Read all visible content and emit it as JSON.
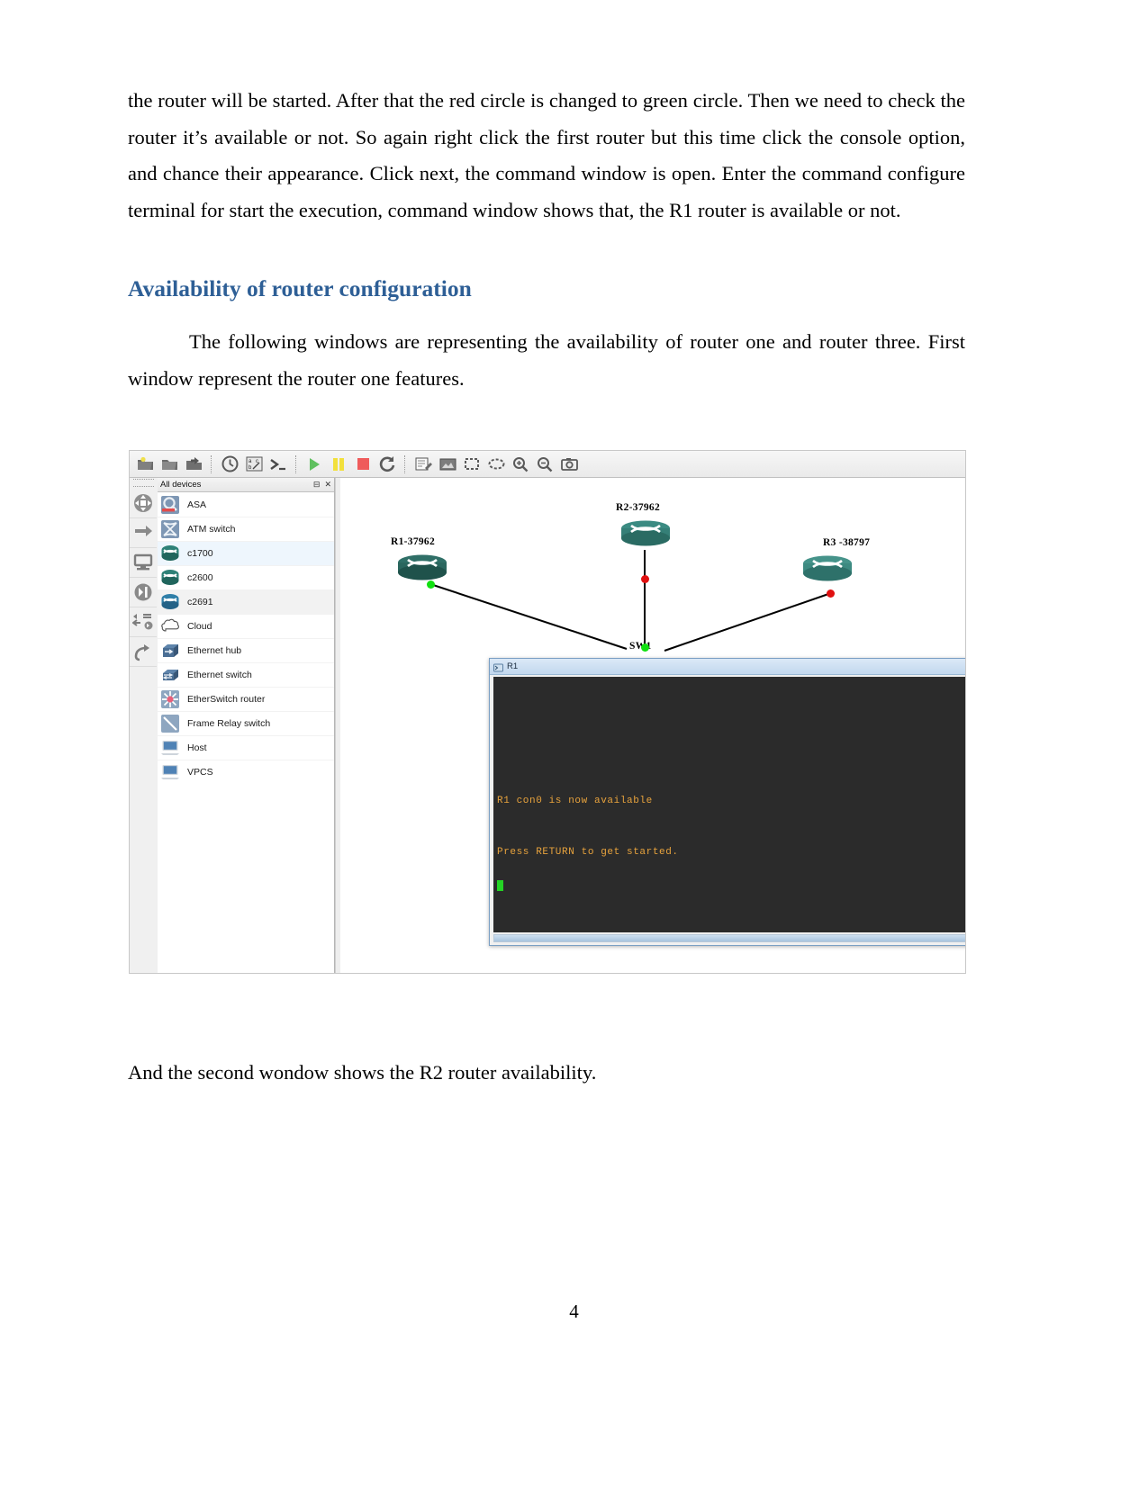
{
  "document": {
    "paragraph_1": "the router will be started. After that the red circle is changed to green circle. Then we need to check the router it’s available or not. So again right click the first router but this time click the console option, and chance their appearance. Click next, the command window is open. Enter the command configure terminal for start the execution, command window shows that, the R1 router is available or not.",
    "heading": "Availability of router configuration",
    "heading_color": "#2e5f96",
    "paragraph_2": "The following windows are representing the availability of router one and router three. First window represent the router one features.",
    "paragraph_3": "And the second wondow shows the R2 router availability.",
    "page_number": "4"
  },
  "gns3": {
    "toolbar": {
      "buttons": [
        {
          "name": "new-project-icon",
          "glyph": "folder-new"
        },
        {
          "name": "open-project-icon",
          "glyph": "folder-open"
        },
        {
          "name": "save-project-icon",
          "glyph": "folder-save"
        },
        {
          "name": "snapshot-icon",
          "glyph": "clock"
        },
        {
          "name": "show-hide-interface-labels-icon",
          "glyph": "abc"
        },
        {
          "name": "console-all-icon",
          "glyph": "prompt"
        },
        {
          "name": "start-all-icon",
          "glyph": "play"
        },
        {
          "name": "suspend-all-icon",
          "glyph": "pause"
        },
        {
          "name": "stop-all-icon",
          "glyph": "stop"
        },
        {
          "name": "reload-all-icon",
          "glyph": "reload"
        },
        {
          "name": "add-note-icon",
          "glyph": "note"
        },
        {
          "name": "insert-picture-icon",
          "glyph": "picture"
        },
        {
          "name": "draw-rectangle-icon",
          "glyph": "rect"
        },
        {
          "name": "draw-ellipse-icon",
          "glyph": "ellipse"
        },
        {
          "name": "zoom-in-icon",
          "glyph": "zoom-in"
        },
        {
          "name": "zoom-out-icon",
          "glyph": "zoom-out"
        },
        {
          "name": "screenshot-icon",
          "glyph": "camera"
        }
      ]
    },
    "rail": {
      "buttons": [
        {
          "name": "routers-rail-icon"
        },
        {
          "name": "switches-rail-icon"
        },
        {
          "name": "end-devices-rail-icon"
        },
        {
          "name": "security-devices-rail-icon"
        },
        {
          "name": "all-devices-rail-icon"
        },
        {
          "name": "add-link-rail-icon"
        }
      ]
    },
    "device_panel": {
      "title": "All devices",
      "pin_icon": "⊟",
      "close_icon": "✕",
      "devices": [
        {
          "label": "ASA",
          "icon": "asa-icon",
          "state": ""
        },
        {
          "label": "ATM switch",
          "icon": "atm-switch-icon",
          "state": ""
        },
        {
          "label": "c1700",
          "icon": "router-icon",
          "state": "hl1"
        },
        {
          "label": "c2600",
          "icon": "router-icon",
          "state": ""
        },
        {
          "label": "c2691",
          "icon": "router-blue-icon",
          "state": "hl2"
        },
        {
          "label": "Cloud",
          "icon": "cloud-icon",
          "state": ""
        },
        {
          "label": "Ethernet hub",
          "icon": "ethernet-hub-icon",
          "state": ""
        },
        {
          "label": "Ethernet switch",
          "icon": "ethernet-switch-icon",
          "state": ""
        },
        {
          "label": "EtherSwitch router",
          "icon": "etherswitch-router-icon",
          "state": ""
        },
        {
          "label": "Frame Relay switch",
          "icon": "frame-relay-switch-icon",
          "state": ""
        },
        {
          "label": "Host",
          "icon": "host-icon",
          "state": ""
        },
        {
          "label": "VPCS",
          "icon": "vpcs-icon",
          "state": ""
        }
      ]
    },
    "topology": {
      "nodes": [
        {
          "id": "r1",
          "label": "R1-37962",
          "type": "router"
        },
        {
          "id": "r2",
          "label": "R2-37962",
          "type": "router"
        },
        {
          "id": "r3",
          "label": "R3 -38797",
          "type": "router"
        },
        {
          "id": "sw1",
          "label": "SW1",
          "type": "switch"
        }
      ],
      "link_status": {
        "r1_side": "green",
        "r2_side": "red",
        "r3_side": "red",
        "sw1_left": "green",
        "sw1_center": "green",
        "sw1_right": "green"
      }
    },
    "console_window": {
      "title": "R1",
      "minimize_label": "─",
      "maximize_label": "❐",
      "close_label": "✕",
      "terminal_lines": [
        "R1 con0 is now available",
        "",
        "",
        "Press RETURN to get started."
      ]
    }
  }
}
